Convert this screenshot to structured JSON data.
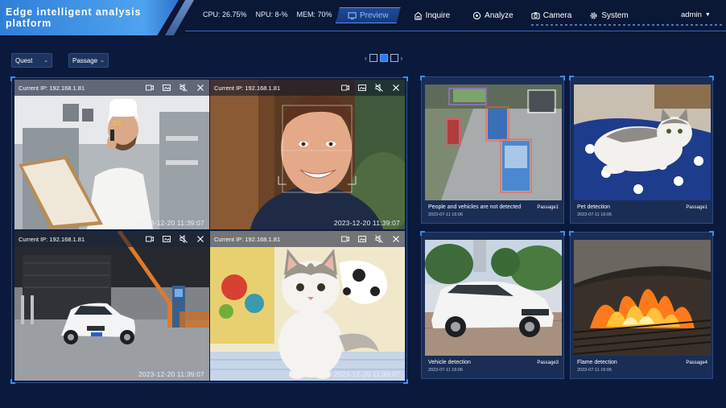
{
  "header": {
    "brand": "Edge intelligent analysis platform",
    "stats": {
      "cpu": "CPU: 26.75%",
      "npu": "NPU: 8-%",
      "mem": "MEM: 70%"
    },
    "nav": [
      {
        "label": "Preview",
        "icon": "preview-icon",
        "active": true
      },
      {
        "label": "Inquire",
        "icon": "inquire-icon"
      },
      {
        "label": "Analyze",
        "icon": "analyze-icon"
      },
      {
        "label": "Camera",
        "icon": "camera-icon"
      },
      {
        "label": "System",
        "icon": "system-icon"
      }
    ],
    "user": "admin"
  },
  "filters": {
    "quest": "Quest",
    "passage": "Passage"
  },
  "layout_switch": {
    "prev": "‹",
    "next": "›"
  },
  "tiles": [
    {
      "ip": "Current IP: 192.168.1.81",
      "timestamp": "2023-12-20 11:39:07"
    },
    {
      "ip": "Current IP: 192.168.1.81",
      "timestamp": "2023-12-20 11:39:07"
    },
    {
      "ip": "Current IP: 192.168.1.81",
      "timestamp": "2023-12-20 11:39:07"
    },
    {
      "ip": "Current IP: 192.168.1.81",
      "timestamp": "2023-12-20 11:39:07"
    }
  ],
  "detections": [
    {
      "title": "People and vehicles are not detected",
      "passage": "Passage1",
      "date": "2023-07-11 16:06"
    },
    {
      "title": "Pet detection",
      "passage": "Passage1",
      "date": "2023-07-11 16:06"
    },
    {
      "title": "Vehicle detection",
      "passage": "Passage3",
      "date": "2023-07-11 16:06"
    },
    {
      "title": "Flame detection",
      "passage": "Passage4",
      "date": "2023-07-11 16:06"
    }
  ],
  "colors": {
    "background": "#0b1a3c",
    "accent": "#3c8cff",
    "brand": "#3f93e6",
    "card": "#1a2d55"
  }
}
